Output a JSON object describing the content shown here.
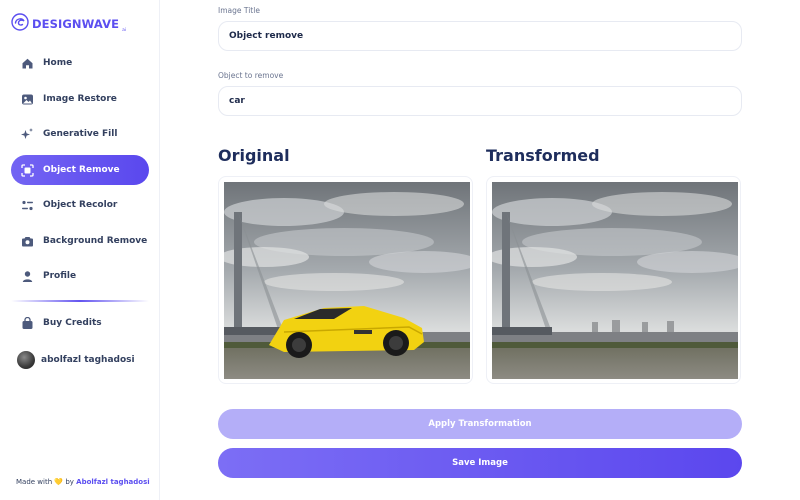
{
  "app": {
    "brand": "DESIGNWAVE",
    "brand_suffix": "ai"
  },
  "sidebar": {
    "items": [
      {
        "label": "Home",
        "icon": "home-icon"
      },
      {
        "label": "Image Restore",
        "icon": "image-icon"
      },
      {
        "label": "Generative Fill",
        "icon": "sparkles-icon"
      },
      {
        "label": "Object Remove",
        "icon": "scan-icon",
        "active": true
      },
      {
        "label": "Object Recolor",
        "icon": "filter-icon"
      },
      {
        "label": "Background Remove",
        "icon": "camera-icon"
      },
      {
        "label": "Profile",
        "icon": "user-icon"
      }
    ],
    "buy_credits": {
      "label": "Buy Credits",
      "icon": "bag-icon"
    },
    "user": {
      "name": "abolfazl taghadosi"
    },
    "footer": {
      "prefix": "Made with",
      "heart": "💛",
      "by": "by",
      "author": "Abolfazl taghadosi"
    }
  },
  "form": {
    "title_label": "Image Title",
    "title_value": "Object remove",
    "object_label": "Object to remove",
    "object_value": "car"
  },
  "panels": {
    "original_title": "Original",
    "transformed_title": "Transformed"
  },
  "actions": {
    "apply_label": "Apply Transformation",
    "save_label": "Save Image"
  },
  "colors": {
    "accent": "#5b4ef0",
    "apply_disabled": "#b4aef8",
    "car": "#f2d211"
  }
}
